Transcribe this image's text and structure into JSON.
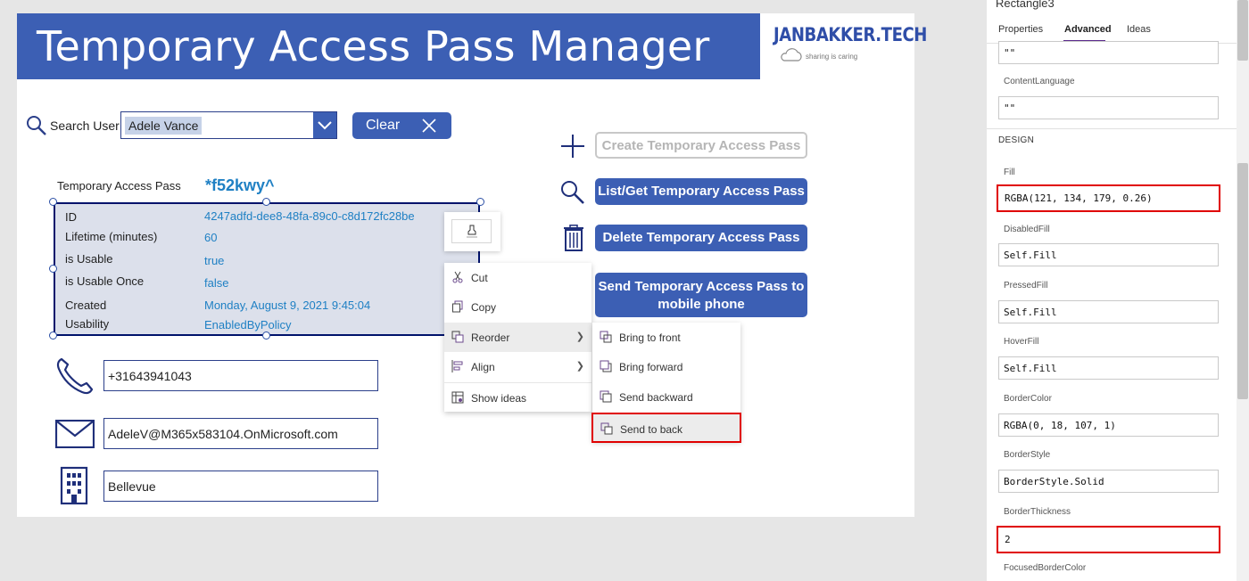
{
  "app": {
    "title": "Temporary Access Pass Manager",
    "logo_brand": "JANBAKKER.TECH",
    "logo_tagline": "sharing is caring"
  },
  "search": {
    "label": "Search User",
    "value": "Adele Vance",
    "clear_label": "Clear"
  },
  "tap": {
    "label": "Temporary Access Pass",
    "code": "*f52kwy^",
    "rows": [
      {
        "label": "ID",
        "value": "4247adfd-dee8-48fa-89c0-c8d172fc28be"
      },
      {
        "label": "Lifetime (minutes)",
        "value": "60"
      },
      {
        "label": "is Usable",
        "value": "true"
      },
      {
        "label": "is Usable Once",
        "value": "false"
      },
      {
        "label": "Created",
        "value": "Monday, August 9, 2021 9:45:04"
      },
      {
        "label": "Usability",
        "value": "EnabledByPolicy"
      }
    ]
  },
  "contact": {
    "phone": "+31643941043",
    "email": "AdeleV@M365x583104.OnMicrosoft.com",
    "office": "Bellevue"
  },
  "actions": {
    "create": "Create Temporary Access Pass",
    "list": "List/Get Temporary Access Pass",
    "delete": "Delete Temporary Access Pass",
    "send_line1": "Send Temporary Access Pass to",
    "send_line2": "mobile phone"
  },
  "context_menu": {
    "items": [
      "Cut",
      "Copy",
      "Reorder",
      "Align",
      "Show ideas"
    ],
    "submenu": [
      "Bring to front",
      "Bring forward",
      "Send backward",
      "Send to back"
    ]
  },
  "properties": {
    "control_name": "Rectangle3",
    "tabs": [
      "Properties",
      "Advanced",
      "Ideas"
    ],
    "active_tab": "Advanced",
    "top_value": "\"\"",
    "content_language_label": "ContentLanguage",
    "content_language": "\"\"",
    "section": "DESIGN",
    "fill_label": "Fill",
    "fill": "RGBA(121, 134, 179, 0.26)",
    "disabled_fill_label": "DisabledFill",
    "disabled_fill": "Self.Fill",
    "pressed_fill_label": "PressedFill",
    "pressed_fill": "Self.Fill",
    "hover_fill_label": "HoverFill",
    "hover_fill": "Self.Fill",
    "border_color_label": "BorderColor",
    "border_color": "RGBA(0, 18, 107, 1)",
    "border_style_label": "BorderStyle",
    "border_style": "BorderStyle.Solid",
    "border_thickness_label": "BorderThickness",
    "border_thickness": "2",
    "focused_border_color_label": "FocusedBorderColor"
  },
  "colors": {
    "title_bar": "#3c5fb4",
    "value_text": "#1f80c4",
    "tab_accent": "#5a2a8b",
    "highlight_red": "#e00000"
  }
}
